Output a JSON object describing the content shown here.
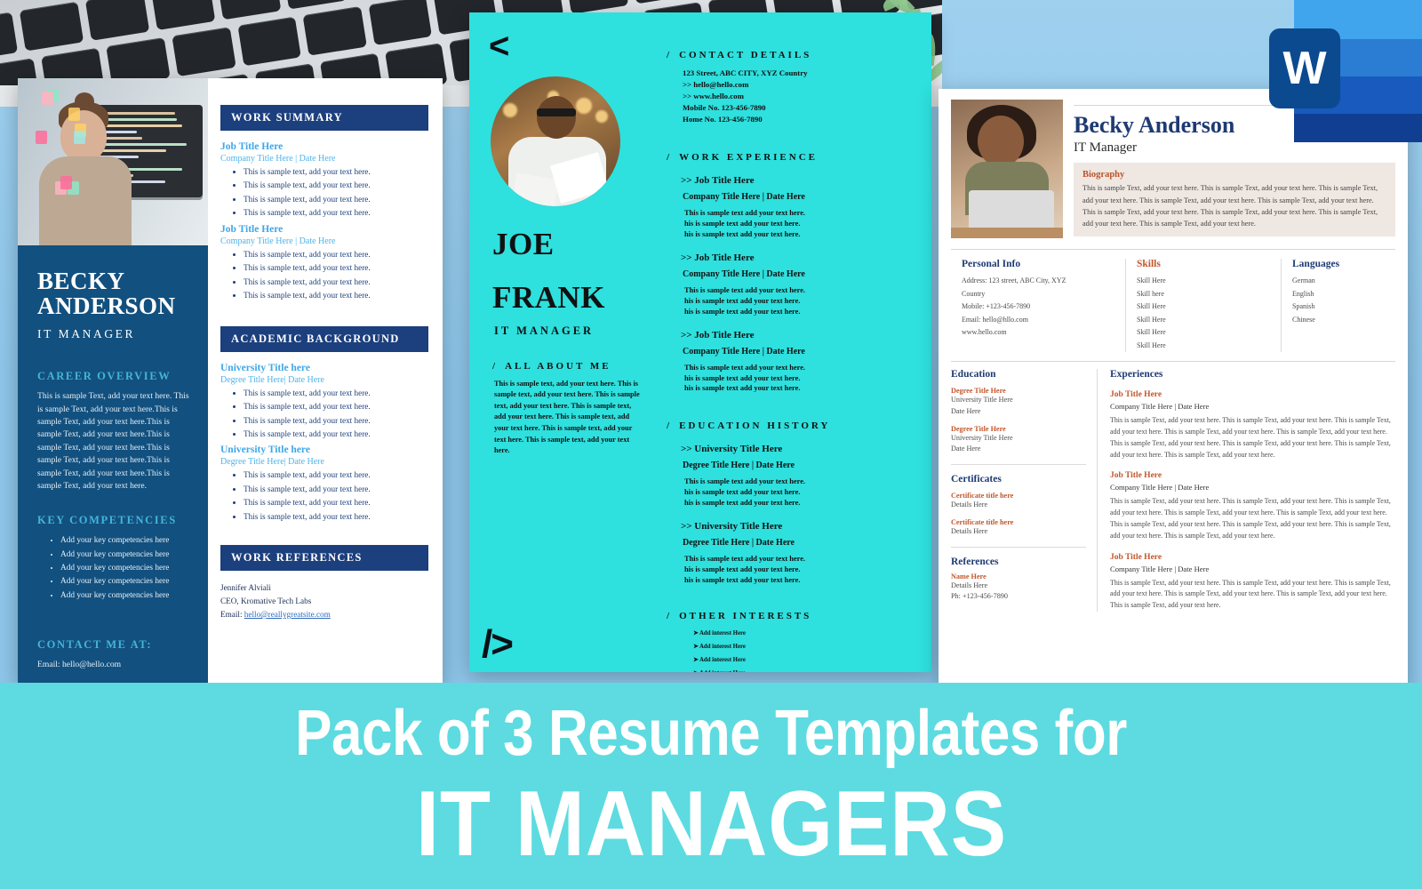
{
  "banner": {
    "line1": "Pack of 3 Resume Templates for",
    "line2": "IT MANAGERS",
    "bg_color": "#5ddbe0"
  },
  "word_icon": {
    "letter": "W",
    "brand_color": "#185abd"
  },
  "resume1": {
    "name_line1": "BECKY",
    "name_line2": "ANDERSON",
    "role": "IT MANAGER",
    "career_overview": {
      "heading": "CAREER OVERVIEW",
      "text": "This is sample Text, add your text here. This is sample Text, add your text here.This is sample Text, add your text here.This is sample Text, add your text here.This is sample Text, add your text here.This is sample Text, add your text here.This is sample Text, add your text here.This is sample Text, add your text here."
    },
    "key_competencies": {
      "heading": "KEY COMPETENCIES",
      "items": [
        "Add your key competencies here",
        "Add your key competencies here",
        "Add your key competencies here",
        "Add your key competencies here",
        "Add your key competencies here"
      ]
    },
    "contact": {
      "heading": "CONTACT ME AT:",
      "email": "Email: hello@hello.com"
    },
    "work_summary": {
      "heading": "WORK SUMMARY",
      "entries": [
        {
          "job_title": "Job Title Here",
          "company": "Company Title Here | Date Here",
          "bullets": [
            "This is sample text, add your text here.",
            "This is sample text, add your text here.",
            "This is sample text, add your text here.",
            "This is sample text, add your text here."
          ]
        },
        {
          "job_title": "Job Title Here",
          "company": "Company Title Here | Date Here",
          "bullets": [
            "This is sample text, add your text here.",
            "This is sample text, add your text here.",
            "This is sample text, add your text here.",
            "This is sample text, add your text here."
          ]
        }
      ]
    },
    "academic": {
      "heading": "ACADEMIC BACKGROUND",
      "entries": [
        {
          "university": "University Title here",
          "degree": "Degree Title Here| Date Here",
          "bullets": [
            "This is sample text, add your text here.",
            "This is sample text, add your text here.",
            "This is sample text, add your text here.",
            "This is sample text, add your text here."
          ]
        },
        {
          "university": "University Title here",
          "degree": "Degree Title Here| Date Here",
          "bullets": [
            "This is sample text, add your text here.",
            "This is sample text, add your text here.",
            "This is sample text, add your text here.",
            "This is sample text, add your text here."
          ]
        }
      ]
    },
    "references": {
      "heading": "WORK REFERENCES",
      "name": "Jennifer Alviali",
      "title": "CEO, Kromative Tech Labs",
      "email_label": "Email:",
      "email": "hello@reallygreatsite.com"
    }
  },
  "resume2": {
    "back_arrow": "<",
    "code_tag": "/>",
    "name_line1": "JOE",
    "name_line2": "FRANK",
    "role": "IT MANAGER",
    "contact": {
      "heading": "CONTACT DETAILS",
      "address": "123 Street, ABC CITY, XYZ Country",
      "email": ">>  hello@hello.com",
      "website": ">>  www.hello.com",
      "mobile": "Mobile No.    123-456-7890",
      "home": "Home No.     123-456-7890"
    },
    "work_experience": {
      "heading": "WORK EXPERIENCE",
      "entries": [
        {
          "job_title": ">> Job Title Here",
          "company": "Company Title Here | Date Here",
          "line1": "This is sample text add your text here.",
          "line2": "his is sample text add your text here.",
          "line3": "his is sample text add your text here."
        },
        {
          "job_title": ">> Job Title Here",
          "company": "Company Title Here | Date Here",
          "line1": "This is sample text add your text here.",
          "line2": "his is sample text add your text here.",
          "line3": "his is sample text add your text here."
        },
        {
          "job_title": ">> Job Title Here",
          "company": "Company Title Here | Date Here",
          "line1": "This is sample text add your text here.",
          "line2": "his is sample text add your text here.",
          "line3": "his is sample text add your text here."
        }
      ]
    },
    "about": {
      "heading": "ALL ABOUT ME",
      "text": "This is sample text, add your text here. This is sample text, add your text here. This is sample text, add your text here. This is sample text, add your text here. This is sample text, add your text here. This is sample text, add your text here. This is sample text, add your text here."
    },
    "education": {
      "heading": "EDUCATION HISTORY",
      "entries": [
        {
          "university": ">> University Title Here",
          "degree": "Degree Title Here | Date Here",
          "line1": "This is sample text add your text here.",
          "line2": "his is sample text add your text here.",
          "line3": "his is sample text add your text here."
        },
        {
          "university": ">> University Title Here",
          "degree": "Degree Title Here | Date Here",
          "line1": "This is sample text add your text here.",
          "line2": "his is sample text add your text here.",
          "line3": "his is sample text add your text here."
        }
      ]
    },
    "interests": {
      "heading": "OTHER INTERESTS",
      "items": [
        "Add interest Here",
        "Add interest Here",
        "Add interest Here",
        "Add interest Here"
      ]
    }
  },
  "resume3": {
    "name": "Becky Anderson",
    "role": "IT Manager",
    "biography": {
      "heading": "Biography",
      "text": "This is sample Text, add your text here. This is sample Text, add your text here. This is sample Text, add your text here. This is sample Text, add your text here. This is sample Text, add your text here. This is sample Text, add your text here. This is sample Text, add your text here. This is sample Text, add your text here. This is sample Text, add your text here."
    },
    "personal_info": {
      "heading": "Personal Info",
      "lines": [
        "Address: 123 street, ABC City, XYZ",
        "Country",
        "Mobile: +123-456-7890",
        "Email: hello@hllo.com",
        "www.hello.com"
      ]
    },
    "skills": {
      "heading": "Skills",
      "items": [
        "Skill Here",
        "Skill here",
        "Skill Here",
        "Skill Here",
        "Skill Here",
        "Skill Here"
      ]
    },
    "languages": {
      "heading": "Languages",
      "items": [
        "German",
        "English",
        "Spanish",
        "Chinese"
      ]
    },
    "education": {
      "heading": "Education",
      "entries": [
        {
          "degree": "Degree Title Here",
          "university": "University Title Here",
          "date": "Date Here"
        },
        {
          "degree": "Degree Title Here",
          "university": "University Title Here",
          "date": "Date Here"
        }
      ]
    },
    "certificates": {
      "heading": "Certificates",
      "entries": [
        {
          "title": "Certificate title here",
          "details": "Details Here"
        },
        {
          "title": "Certificate title here",
          "details": "Details Here"
        }
      ]
    },
    "references": {
      "heading": "References",
      "name": "Name Here",
      "details": "Details Here",
      "phone": "Ph: +123-456-7890"
    },
    "experiences": {
      "heading": "Experiences",
      "entries": [
        {
          "job_title": "Job Title Here",
          "company": "Company Title Here | Date Here",
          "text": "This is sample Text, add your text here. This is sample Text, add your text here. This is sample Text, add your text here. This is sample Text, add your text here. This is sample Text, add your text here. This is sample Text, add your text here. This is sample Text, add your text here. This is sample Text, add your text here. This is sample Text, add your text here."
        },
        {
          "job_title": "Job Title Here",
          "company": "Company Title Here | Date Here",
          "text": "This is sample Text, add your text here. This is sample Text, add your text here. This is sample Text, add your text here. This is sample Text, add your text here. This is sample Text, add your text here. This is sample Text, add your text here. This is sample Text, add your text here. This is sample Text, add your text here. This is sample Text, add your text here."
        },
        {
          "job_title": "Job Title Here",
          "company": "Company Title Here | Date Here",
          "text": "This is sample Text, add your text here. This is sample Text, add your text here. This is sample Text, add your text here. This is sample Text, add your text here. This is sample Text, add your text here. This is sample Text, add your text here."
        }
      ]
    }
  }
}
